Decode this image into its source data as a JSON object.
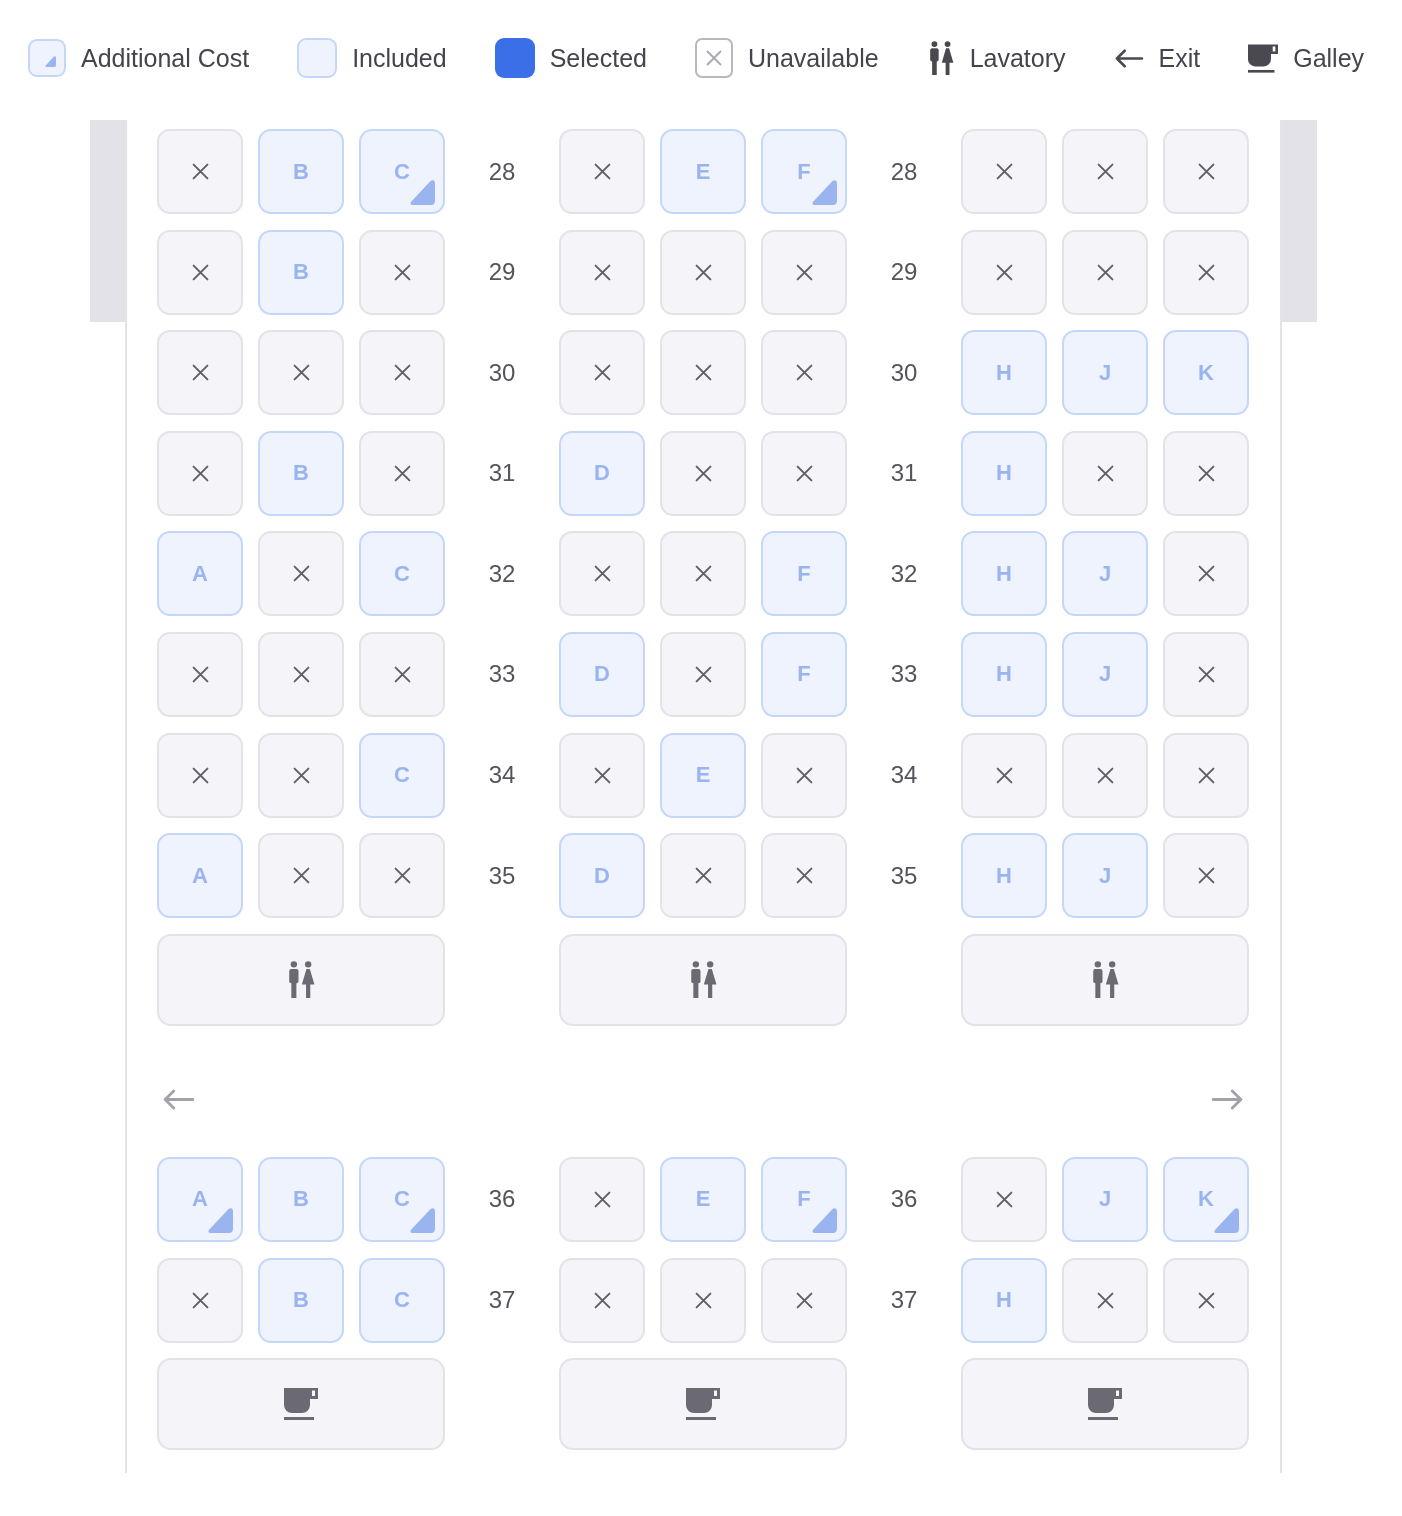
{
  "legend": [
    {
      "kind": "additional_cost",
      "label": "Additional Cost"
    },
    {
      "kind": "included",
      "label": "Included"
    },
    {
      "kind": "selected",
      "label": "Selected"
    },
    {
      "kind": "unavailable",
      "label": "Unavailable"
    },
    {
      "kind": "lavatory",
      "label": "Lavatory"
    },
    {
      "kind": "exit",
      "label": "Exit"
    },
    {
      "kind": "galley",
      "label": "Galley"
    }
  ],
  "cabin": {
    "rows": [
      {
        "kind": "seats",
        "numbers": [
          "28",
          "28"
        ],
        "blocks": [
          [
            {
              "kind": "unavailable"
            },
            {
              "kind": "included",
              "letter": "B",
              "selected": false
            },
            {
              "kind": "extra",
              "letter": "C",
              "selected": false
            }
          ],
          [
            {
              "kind": "unavailable"
            },
            {
              "kind": "included",
              "letter": "E",
              "selected": false
            },
            {
              "kind": "extra",
              "letter": "F",
              "selected": false
            }
          ],
          [
            {
              "kind": "unavailable"
            },
            {
              "kind": "unavailable"
            },
            {
              "kind": "unavailable"
            }
          ]
        ]
      },
      {
        "kind": "seats",
        "numbers": [
          "29",
          "29"
        ],
        "blocks": [
          [
            {
              "kind": "unavailable"
            },
            {
              "kind": "included",
              "letter": "B",
              "selected": false
            },
            {
              "kind": "unavailable"
            }
          ],
          [
            {
              "kind": "unavailable"
            },
            {
              "kind": "unavailable"
            },
            {
              "kind": "unavailable"
            }
          ],
          [
            {
              "kind": "unavailable"
            },
            {
              "kind": "unavailable"
            },
            {
              "kind": "unavailable"
            }
          ]
        ]
      },
      {
        "kind": "seats",
        "numbers": [
          "30",
          "30"
        ],
        "blocks": [
          [
            {
              "kind": "unavailable"
            },
            {
              "kind": "unavailable"
            },
            {
              "kind": "unavailable"
            }
          ],
          [
            {
              "kind": "unavailable"
            },
            {
              "kind": "unavailable"
            },
            {
              "kind": "unavailable"
            }
          ],
          [
            {
              "kind": "included",
              "letter": "H",
              "selected": false
            },
            {
              "kind": "included",
              "letter": "J",
              "selected": false
            },
            {
              "kind": "included",
              "letter": "K",
              "selected": false
            }
          ]
        ]
      },
      {
        "kind": "seats",
        "numbers": [
          "31",
          "31"
        ],
        "blocks": [
          [
            {
              "kind": "unavailable"
            },
            {
              "kind": "included",
              "letter": "B",
              "selected": false
            },
            {
              "kind": "unavailable"
            }
          ],
          [
            {
              "kind": "included",
              "letter": "D",
              "selected": false
            },
            {
              "kind": "unavailable"
            },
            {
              "kind": "unavailable"
            }
          ],
          [
            {
              "kind": "included",
              "letter": "H",
              "selected": false
            },
            {
              "kind": "unavailable"
            },
            {
              "kind": "unavailable"
            }
          ]
        ]
      },
      {
        "kind": "seats",
        "numbers": [
          "32",
          "32"
        ],
        "blocks": [
          [
            {
              "kind": "included",
              "letter": "A",
              "selected": false
            },
            {
              "kind": "unavailable"
            },
            {
              "kind": "included",
              "letter": "C",
              "selected": false
            }
          ],
          [
            {
              "kind": "unavailable"
            },
            {
              "kind": "unavailable"
            },
            {
              "kind": "included",
              "letter": "F",
              "selected": false
            }
          ],
          [
            {
              "kind": "included",
              "letter": "H",
              "selected": false
            },
            {
              "kind": "included",
              "letter": "J",
              "selected": false
            },
            {
              "kind": "unavailable"
            }
          ]
        ]
      },
      {
        "kind": "seats",
        "numbers": [
          "33",
          "33"
        ],
        "blocks": [
          [
            {
              "kind": "unavailable"
            },
            {
              "kind": "unavailable"
            },
            {
              "kind": "unavailable"
            }
          ],
          [
            {
              "kind": "included",
              "letter": "D",
              "selected": false
            },
            {
              "kind": "unavailable"
            },
            {
              "kind": "included",
              "letter": "F",
              "selected": false
            }
          ],
          [
            {
              "kind": "included",
              "letter": "H",
              "selected": false
            },
            {
              "kind": "included",
              "letter": "J",
              "selected": false
            },
            {
              "kind": "unavailable"
            }
          ]
        ]
      },
      {
        "kind": "seats",
        "numbers": [
          "34",
          "34"
        ],
        "blocks": [
          [
            {
              "kind": "unavailable"
            },
            {
              "kind": "unavailable"
            },
            {
              "kind": "included",
              "letter": "C",
              "selected": false
            }
          ],
          [
            {
              "kind": "unavailable"
            },
            {
              "kind": "included",
              "letter": "E",
              "selected": false
            },
            {
              "kind": "unavailable"
            }
          ],
          [
            {
              "kind": "unavailable"
            },
            {
              "kind": "unavailable"
            },
            {
              "kind": "unavailable"
            }
          ]
        ]
      },
      {
        "kind": "seats",
        "numbers": [
          "35",
          "35"
        ],
        "blocks": [
          [
            {
              "kind": "included",
              "letter": "A",
              "selected": false
            },
            {
              "kind": "unavailable"
            },
            {
              "kind": "unavailable"
            }
          ],
          [
            {
              "kind": "included",
              "letter": "D",
              "selected": false
            },
            {
              "kind": "unavailable"
            },
            {
              "kind": "unavailable"
            }
          ],
          [
            {
              "kind": "included",
              "letter": "H",
              "selected": false
            },
            {
              "kind": "included",
              "letter": "J",
              "selected": false
            },
            {
              "kind": "unavailable"
            }
          ]
        ]
      },
      {
        "kind": "facilities",
        "blocks": [
          {
            "kind": "lavatory"
          },
          {
            "kind": "lavatory"
          },
          {
            "kind": "lavatory"
          }
        ]
      },
      {
        "kind": "exits",
        "exits": [
          {
            "kind": "left"
          },
          {
            "kind": "right"
          }
        ]
      },
      {
        "kind": "seats",
        "numbers": [
          "36",
          "36"
        ],
        "blocks": [
          [
            {
              "kind": "extra",
              "letter": "A",
              "selected": false
            },
            {
              "kind": "included",
              "letter": "B",
              "selected": false
            },
            {
              "kind": "extra",
              "letter": "C",
              "selected": false
            }
          ],
          [
            {
              "kind": "unavailable"
            },
            {
              "kind": "included",
              "letter": "E",
              "selected": false
            },
            {
              "kind": "extra",
              "letter": "F",
              "selected": false
            }
          ],
          [
            {
              "kind": "unavailable"
            },
            {
              "kind": "included",
              "letter": "J",
              "selected": false
            },
            {
              "kind": "extra",
              "letter": "K",
              "selected": false
            }
          ]
        ]
      },
      {
        "kind": "seats",
        "numbers": [
          "37",
          "37"
        ],
        "blocks": [
          [
            {
              "kind": "unavailable"
            },
            {
              "kind": "included",
              "letter": "B",
              "selected": false
            },
            {
              "kind": "included",
              "letter": "C",
              "selected": false
            }
          ],
          [
            {
              "kind": "unavailable"
            },
            {
              "kind": "unavailable"
            },
            {
              "kind": "unavailable"
            }
          ],
          [
            {
              "kind": "included",
              "letter": "H",
              "selected": false
            },
            {
              "kind": "unavailable"
            },
            {
              "kind": "unavailable"
            }
          ]
        ]
      },
      {
        "kind": "facilities",
        "blocks": [
          {
            "kind": "galley"
          },
          {
            "kind": "galley"
          },
          {
            "kind": "galley"
          }
        ]
      }
    ]
  }
}
